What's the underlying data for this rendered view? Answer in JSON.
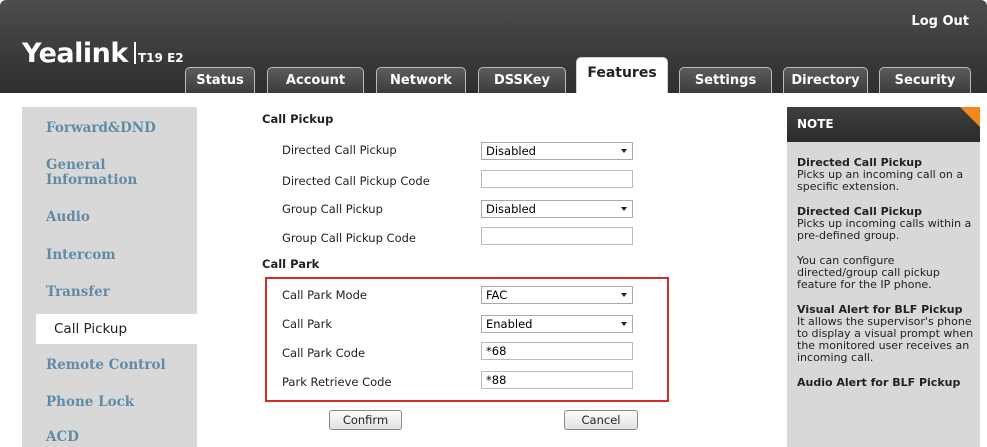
{
  "header": {
    "brand": "Yealink",
    "model": "T19 E2",
    "logout": "Log Out"
  },
  "tabs": [
    {
      "label": "Status"
    },
    {
      "label": "Account"
    },
    {
      "label": "Network"
    },
    {
      "label": "DSSKey"
    },
    {
      "label": "Features",
      "active": true
    },
    {
      "label": "Settings"
    },
    {
      "label": "Directory"
    },
    {
      "label": "Security"
    }
  ],
  "sidebar": {
    "items": [
      {
        "label": "Forward&DND"
      },
      {
        "label": "General Information"
      },
      {
        "label": "Audio"
      },
      {
        "label": "Intercom"
      },
      {
        "label": "Transfer"
      },
      {
        "label": "Call Pickup",
        "active": true
      },
      {
        "label": "Remote Control"
      },
      {
        "label": "Phone Lock"
      },
      {
        "label": "ACD"
      }
    ]
  },
  "call_pickup": {
    "section_title": "Call Pickup",
    "directed_label": "Directed Call Pickup",
    "directed_value": "Disabled",
    "directed_code_label": "Directed Call Pickup Code",
    "directed_code_value": "",
    "group_label": "Group Call Pickup",
    "group_value": "Disabled",
    "group_code_label": "Group Call Pickup Code",
    "group_code_value": ""
  },
  "call_park": {
    "section_title": "Call Park",
    "mode_label": "Call Park Mode",
    "mode_value": "FAC",
    "park_label": "Call Park",
    "park_value": "Enabled",
    "code_label": "Call Park Code",
    "code_value": "*68",
    "retrieve_label": "Park Retrieve Code",
    "retrieve_value": "*88"
  },
  "buttons": {
    "confirm": "Confirm",
    "cancel": "Cancel"
  },
  "note": {
    "title": "NOTE",
    "blocks": [
      {
        "title": "Directed Call Pickup",
        "text": "Picks up an incoming call on a specific extension."
      },
      {
        "title": "Directed Call Pickup",
        "text": "Picks up incoming calls within a pre-defined group."
      },
      {
        "title": "",
        "text": "You can configure directed/group call pickup feature for the IP phone."
      },
      {
        "title": "Visual Alert for BLF Pickup",
        "text": "It allows the supervisor's phone to display a visual prompt when the monitored user receives an incoming call."
      },
      {
        "title": "Audio Alert for BLF Pickup",
        "text": ""
      }
    ]
  },
  "colors": {
    "header_bg": "#3a3a3a",
    "sidebar_link": "#5f8ba6",
    "highlight_border": "#d42a2a",
    "note_accent": "#f08a1c"
  }
}
